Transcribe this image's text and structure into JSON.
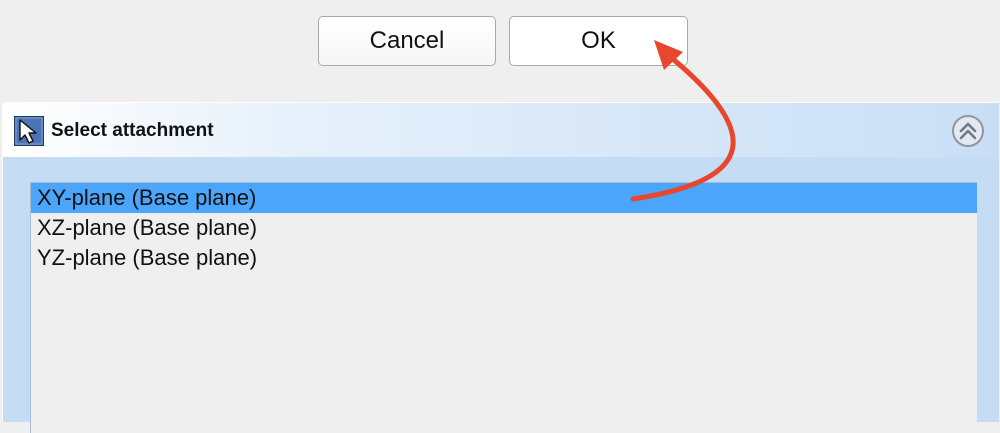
{
  "dialog": {
    "cancel_label": "Cancel",
    "ok_label": "OK"
  },
  "panel": {
    "title": "Select attachment",
    "header_icon": "arrow-cursor-icon",
    "collapse_icon": "double-chevron-up-icon",
    "items": [
      {
        "label": "XY-plane (Base plane)",
        "selected": true
      },
      {
        "label": "XZ-plane (Base plane)",
        "selected": false
      },
      {
        "label": "YZ-plane (Base plane)",
        "selected": false
      }
    ]
  },
  "annotation": {
    "arrow_color": "#e8472e"
  },
  "colors": {
    "selection": "#4aa5fb",
    "panel_background": "#c5dcf5",
    "window_background": "#efefef"
  }
}
